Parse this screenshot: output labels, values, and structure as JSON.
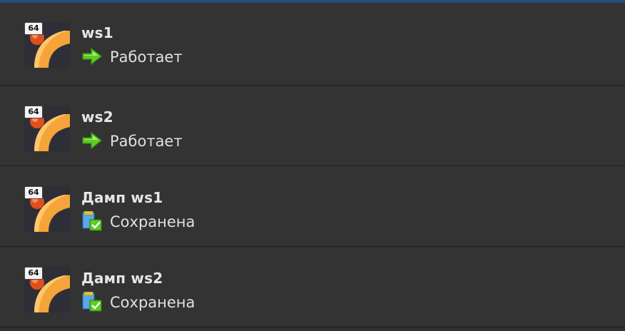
{
  "vms": [
    {
      "name": "ws1",
      "arch_badge": "64",
      "state": "Работает",
      "state_icon": "running-arrow-icon"
    },
    {
      "name": "ws2",
      "arch_badge": "64",
      "state": "Работает",
      "state_icon": "running-arrow-icon"
    },
    {
      "name": "Дамп ws1",
      "arch_badge": "64",
      "state": "Сохранена",
      "state_icon": "saved-state-icon"
    },
    {
      "name": "Дамп ws2",
      "arch_badge": "64",
      "state": "Сохранена",
      "state_icon": "saved-state-icon"
    }
  ],
  "colors": {
    "background": "#333333",
    "separator": "#1e1e1e",
    "name_text": "#e6e6e6",
    "state_text": "#e0e0e0",
    "logo_orange": "#f5a43a",
    "logo_red": "#e0501c",
    "running_green": "#5ccd22",
    "top_accent": "#2a4a78"
  }
}
